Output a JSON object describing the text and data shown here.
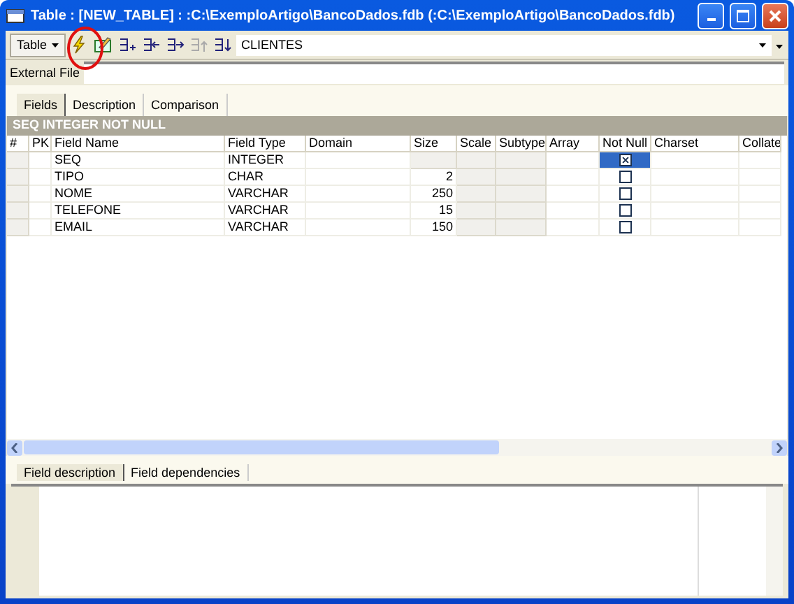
{
  "window": {
    "title": "Table : [NEW_TABLE] : :C:\\ExemploArtigo\\BancoDados.fdb (:C:\\ExemploArtigo\\BancoDados.fdb)"
  },
  "toolbar": {
    "menu_button": "Table",
    "table_combo": "CLIENTES"
  },
  "external_file": {
    "label": "External File"
  },
  "tabs": [
    {
      "label": "Fields",
      "selected": true
    },
    {
      "label": "Description",
      "selected": false
    },
    {
      "label": "Comparison",
      "selected": false
    }
  ],
  "field_summary": "SEQ INTEGER NOT NULL",
  "columns": [
    {
      "label": "#",
      "disabled": true
    },
    {
      "label": "PK",
      "disabled": false
    },
    {
      "label": "Field Name",
      "disabled": false
    },
    {
      "label": "Field Type",
      "disabled": false
    },
    {
      "label": "Domain",
      "disabled": false
    },
    {
      "label": "Size",
      "disabled": false
    },
    {
      "label": "Scale",
      "disabled": true
    },
    {
      "label": "Subtype",
      "disabled": true
    },
    {
      "label": "Array",
      "disabled": false
    },
    {
      "label": "Not Null",
      "disabled": false
    },
    {
      "label": "Charset",
      "disabled": false
    },
    {
      "label": "Collate",
      "disabled": false
    }
  ],
  "rows": [
    {
      "name": "SEQ",
      "type": "INTEGER",
      "size": "",
      "not_null": true,
      "selected": true
    },
    {
      "name": "TIPO",
      "type": "CHAR",
      "size": "2",
      "not_null": false,
      "selected": false
    },
    {
      "name": "NOME",
      "type": "VARCHAR",
      "size": "250",
      "not_null": false,
      "selected": false
    },
    {
      "name": "TELEFONE",
      "type": "VARCHAR",
      "size": "15",
      "not_null": false,
      "selected": false
    },
    {
      "name": "EMAIL",
      "type": "VARCHAR",
      "size": "150",
      "not_null": false,
      "selected": false
    }
  ],
  "bottom_tabs": [
    {
      "label": "Field description",
      "selected": true
    },
    {
      "label": "Field dependencies",
      "selected": false
    }
  ]
}
